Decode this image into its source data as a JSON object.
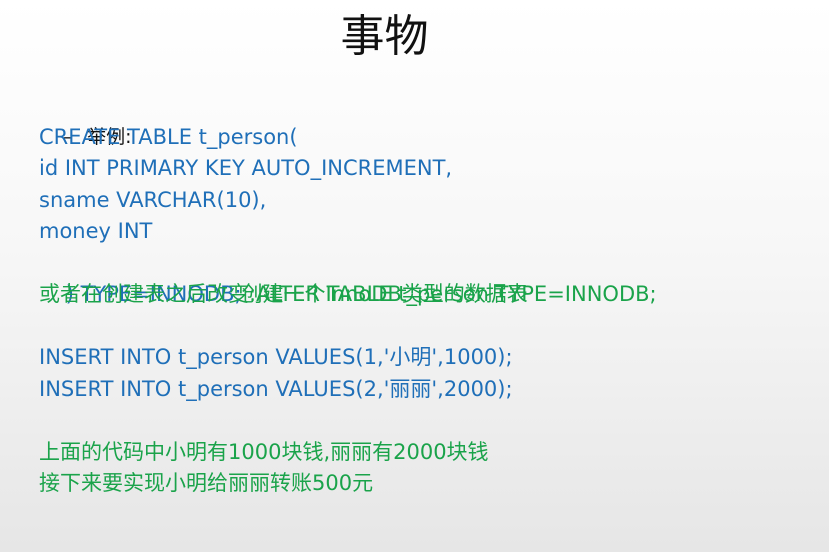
{
  "slide": {
    "title": "事物",
    "bullet": {
      "marker": "–",
      "label": "举例:"
    },
    "code_block_1": [
      "CREATE TABLE t_person(",
      "id INT PRIMARY KEY AUTO_INCREMENT,",
      "sname VARCHAR(10),",
      "money INT"
    ],
    "line_type_code": ") TYPE=INNODB;",
    "line_type_comment": "创建一个InnoDB类型的数据表",
    "line_alter": "或者在创建表之后改变:ALTER TABLE t_person TYPE=INNODB;",
    "code_block_2": [
      "INSERT INTO t_person VALUES(1,'小明',1000);",
      "INSERT INTO t_person VALUES(2,'丽丽',2000);"
    ],
    "notes": [
      "上面的代码中小明有1000块钱,丽丽有2000块钱",
      "接下来要实现小明给丽丽转账500元"
    ],
    "colors": {
      "code": "#1f6fb8",
      "comment": "#1aa34a",
      "title": "#111111"
    }
  }
}
